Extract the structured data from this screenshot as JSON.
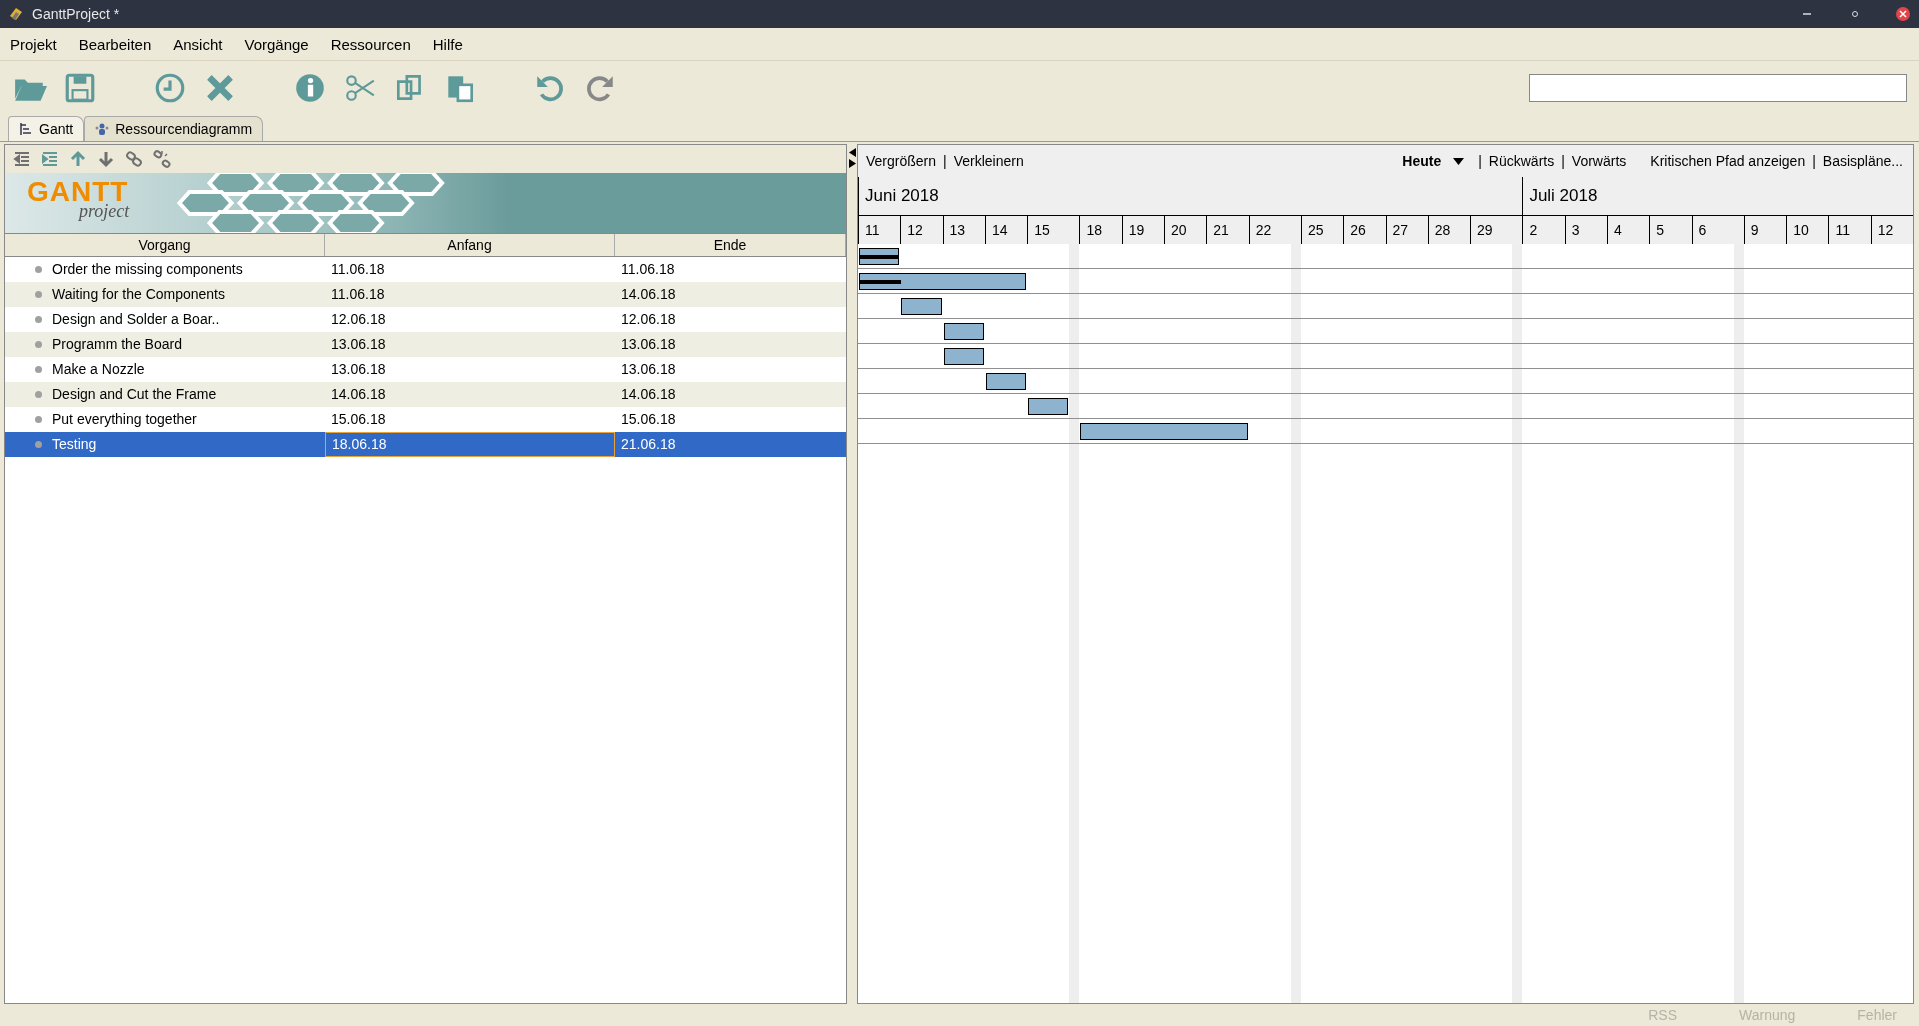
{
  "window": {
    "title": "GanttProject *"
  },
  "menu": [
    "Projekt",
    "Bearbeiten",
    "Ansicht",
    "Vorgänge",
    "Ressourcen",
    "Hilfe"
  ],
  "tabs": [
    {
      "label": "Gantt",
      "selected": true
    },
    {
      "label": "Ressourcendiagramm",
      "selected": false
    }
  ],
  "banner": {
    "logo_title": "GANTT",
    "logo_subtitle": "project"
  },
  "table": {
    "columns": [
      "Vorgang",
      "Anfang",
      "Ende"
    ],
    "rows": [
      {
        "name": "Order the missing components",
        "start": "11.06.18",
        "end": "11.06.18",
        "level": 1,
        "selected": false
      },
      {
        "name": "Waiting for the Components",
        "start": "11.06.18",
        "end": "14.06.18",
        "level": 0.25,
        "selected": false
      },
      {
        "name": "Design and Solder a Boar..",
        "start": "12.06.18",
        "end": "12.06.18",
        "level": 0,
        "selected": false
      },
      {
        "name": "Programm the Board",
        "start": "13.06.18",
        "end": "13.06.18",
        "level": 0,
        "selected": false
      },
      {
        "name": "Make a Nozzle",
        "start": "13.06.18",
        "end": "13.06.18",
        "level": 0,
        "selected": false
      },
      {
        "name": "Design and Cut the Frame",
        "start": "14.06.18",
        "end": "14.06.18",
        "level": 0,
        "selected": false
      },
      {
        "name": "Put everything together",
        "start": "15.06.18",
        "end": "15.06.18",
        "level": 0,
        "selected": false
      },
      {
        "name": "Testing",
        "start": "18.06.18",
        "end": "21.06.18",
        "level": 0,
        "selected": true
      }
    ]
  },
  "chart_toolbar": [
    {
      "kind": "link",
      "label": "Vergrößern"
    },
    {
      "kind": "separator",
      "label": "|"
    },
    {
      "kind": "link",
      "label": "Verkleinern"
    },
    {
      "kind": "dropdown",
      "label": "Heute"
    },
    {
      "kind": "separator",
      "label": "|"
    },
    {
      "kind": "link",
      "label": "Rückwärts"
    },
    {
      "kind": "separator",
      "label": "|"
    },
    {
      "kind": "link",
      "label": "Vorwärts"
    },
    {
      "kind": "link",
      "label": "Kritischen Pfad anzeigen"
    },
    {
      "kind": "separator",
      "label": "|"
    },
    {
      "kind": "link",
      "label": "Basispläne..."
    }
  ],
  "timeline": [
    {
      "label": "Juni 2018",
      "days": [
        {
          "label": "11",
          "weekend_after": false
        },
        {
          "label": "12",
          "weekend_after": false
        },
        {
          "label": "13",
          "weekend_after": false
        },
        {
          "label": "14",
          "weekend_after": false
        },
        {
          "label": "15",
          "weekend_after": true
        },
        {
          "label": "18",
          "weekend_after": false
        },
        {
          "label": "19",
          "weekend_after": false
        },
        {
          "label": "20",
          "weekend_after": false
        },
        {
          "label": "21",
          "weekend_after": false
        },
        {
          "label": "22",
          "weekend_after": true
        },
        {
          "label": "25",
          "weekend_after": false
        },
        {
          "label": "26",
          "weekend_after": false
        },
        {
          "label": "27",
          "weekend_after": false
        },
        {
          "label": "28",
          "weekend_after": false
        },
        {
          "label": "29",
          "weekend_after": true
        }
      ]
    },
    {
      "label": "Juli 2018",
      "days": [
        {
          "label": "2",
          "weekend_after": false
        },
        {
          "label": "3",
          "weekend_after": false
        },
        {
          "label": "4",
          "weekend_after": false
        },
        {
          "label": "5",
          "weekend_after": false
        },
        {
          "label": "6",
          "weekend_after": true
        },
        {
          "label": "9",
          "weekend_after": false
        },
        {
          "label": "10",
          "weekend_after": false
        },
        {
          "label": "11",
          "weekend_after": false
        },
        {
          "label": "12",
          "weekend_after": false
        }
      ]
    }
  ],
  "status_bar": [
    "RSS",
    "Warnung",
    "Fehler"
  ]
}
